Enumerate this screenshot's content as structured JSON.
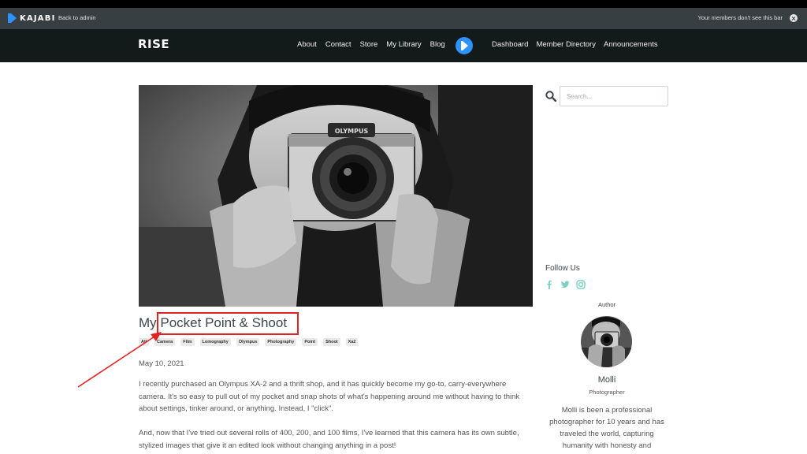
{
  "admin_bar": {
    "logo_text": "KAJABI",
    "back_label": "Back to admin",
    "notice": "Your members don't see this bar"
  },
  "nav": {
    "brand": "RISE",
    "links": [
      "About",
      "Contact",
      "Store",
      "My Library",
      "Blog"
    ],
    "right_links": [
      "Dashboard",
      "Member Directory",
      "Announcements"
    ]
  },
  "post": {
    "title": "My Pocket Point & Shoot",
    "tags": [
      "All",
      "Camera",
      "Film",
      "Lomography",
      "Olympus",
      "Photography",
      "Point",
      "Shoot",
      "Xa2"
    ],
    "date": "May 10, 2021",
    "paragraphs": [
      "I recently purchased an Olympus XA-2 and a thrift shop, and it has quickly become my go-to, carry-everywhere camera. It's so easy to pull out of my pocket and snap shots of what's happening around me without having to think about settings, tinker around, or anything. Instead, I \"click\".",
      "And, now that I've tried out several rolls of 400, 200, and 100 films, I've learned that this camera has its own subtle, stylized images that give it an edited look without changing anything in a post!"
    ]
  },
  "sidebar": {
    "search_placeholder": "Search...",
    "follow_title": "Follow Us",
    "social_icons": [
      "facebook-icon",
      "twitter-icon",
      "instagram-icon"
    ],
    "author_label": "Author",
    "author_name": "Molli",
    "author_role": "Photographer",
    "author_bio": "Molli is been a professional photographer for 10 years and has traveled the world, capturing humanity with honesty and"
  },
  "colors": {
    "admin_bar": "#373f42",
    "nav_bg": "#121a1a",
    "accent_blue": "#2e91fc",
    "social_teal": "#7cd1c4",
    "annotation_red": "#e02424"
  }
}
